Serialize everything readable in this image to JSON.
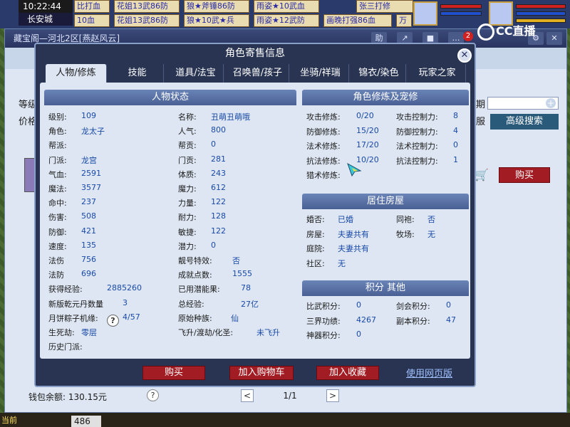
{
  "top_bar": {
    "time": "10:22:44",
    "map_name": "长安城",
    "ticker_row1": [
      "比打血",
      "花姐13武86防",
      "狼★斧锤86防",
      "雨姿★10武血",
      "张三打修"
    ],
    "ticker_row2": [
      "10血",
      "花姐13武86防",
      "狼★10武★兵",
      "雨姿★12武防",
      "画晚打强86血",
      "万"
    ]
  },
  "store": {
    "title": "藏宝阁—河北2区[燕赵风云]",
    "btn_labels": [
      "助",
      "↗",
      "■",
      "…"
    ],
    "notification_count": "2",
    "side_labels": [
      "等级",
      "价格"
    ],
    "side_label_right": "期",
    "side_label_right2": "服",
    "advanced_search": "高级搜索",
    "buy_button": "购买",
    "wallet": "钱包余额: 130.15元",
    "help": "?",
    "pager_prev": "<",
    "pager_text": "1/1",
    "pager_next": ">"
  },
  "overlay": {
    "cc_logo": "CC直播"
  },
  "bottom": {
    "left_label": "当前",
    "count": "486"
  },
  "dialog": {
    "title": "角色寄售信息",
    "close": "✕",
    "tabs": [
      "人物/修炼",
      "技能",
      "道具/法宝",
      "召唤兽/孩子",
      "坐骑/祥瑞",
      "锦衣/染色",
      "玩家之家"
    ],
    "left_panel": {
      "heading": "人物状态",
      "rows": [
        {
          "l1": "级别:",
          "v1": "109",
          "l2": "名称:",
          "v2": "丑萌丑萌哦"
        },
        {
          "l1": "角色:",
          "v1": "龙太子",
          "l2": "人气:",
          "v2": "800"
        },
        {
          "l1": "帮派:",
          "v1": "",
          "l2": "帮贡:",
          "v2": "0"
        },
        {
          "l1": "门派:",
          "v1": "龙宫",
          "l2": "门贡:",
          "v2": "281"
        },
        {
          "l1": "气血:",
          "v1": "2591",
          "l2": "体质:",
          "v2": "243"
        },
        {
          "l1": "魔法:",
          "v1": "3577",
          "l2": "魔力:",
          "v2": "612"
        },
        {
          "l1": "命中:",
          "v1": "237",
          "l2": "力量:",
          "v2": "122"
        },
        {
          "l1": "伤害:",
          "v1": "508",
          "l2": "耐力:",
          "v2": "128"
        },
        {
          "l1": "防御:",
          "v1": "421",
          "l2": "敏捷:",
          "v2": "122"
        },
        {
          "l1": "速度:",
          "v1": "135",
          "l2": "潜力:",
          "v2": "0"
        },
        {
          "l1": "法伤",
          "v1": "756",
          "l2": "靓号特效:",
          "v2": "否"
        },
        {
          "l1": "法防",
          "v1": "696",
          "l2": "成就点数:",
          "v2": "1555"
        },
        {
          "l1": "获得经验:",
          "v1": "2885260",
          "l2": "已用潜能果:",
          "v2": "78"
        },
        {
          "l1": "新版乾元丹数量",
          "v1": "3",
          "l2": "总经验:",
          "v2": "27亿"
        },
        {
          "l1": "月饼粽子机缘:",
          "v1": "4/57",
          "l2": "原始种族:",
          "v2": "仙"
        },
        {
          "l1": "生死劫:",
          "v1": "零层",
          "l2": "飞升/渡劫/化圣:",
          "v2": "未飞升"
        },
        {
          "l1": "历史门派:",
          "v1": "",
          "l2": "",
          "v2": ""
        }
      ]
    },
    "cultivation_panel": {
      "heading": "角色修炼及宠修",
      "rows": [
        {
          "l1": "攻击修炼:",
          "v1": "0/20",
          "l2": "攻击控制力:",
          "v2": "8"
        },
        {
          "l1": "防御修炼:",
          "v1": "15/20",
          "l2": "防御控制力:",
          "v2": "4"
        },
        {
          "l1": "法术修炼:",
          "v1": "17/20",
          "l2": "法术控制力:",
          "v2": "0"
        },
        {
          "l1": "抗法修炼:",
          "v1": "10/20",
          "l2": "抗法控制力:",
          "v2": "1"
        },
        {
          "l1": "猎术修炼:",
          "v1": "",
          "l2": "",
          "v2": ""
        }
      ]
    },
    "house_panel": {
      "heading": "居住房屋",
      "rows": [
        {
          "l1": "婚否:",
          "v1": "已婚",
          "l2": "同袍:",
          "v2": "否"
        },
        {
          "l1": "房屋:",
          "v1": "夫妻共有",
          "l2": "牧场:",
          "v2": "无"
        },
        {
          "l1": "庭院:",
          "v1": "夫妻共有",
          "l2": "",
          "v2": ""
        },
        {
          "l1": "社区:",
          "v1": "无",
          "l2": "",
          "v2": ""
        }
      ]
    },
    "points_panel": {
      "heading": "积分 其他",
      "rows": [
        {
          "l1": "比武积分:",
          "v1": "0",
          "l2": "剑会积分:",
          "v2": "0"
        },
        {
          "l1": "三界功绩:",
          "v1": "4267",
          "l2": "副本积分:",
          "v2": "47"
        },
        {
          "l1": "神器积分:",
          "v1": "0",
          "l2": "",
          "v2": ""
        }
      ]
    },
    "help_icon": "?",
    "buttons": {
      "buy": "购买",
      "add_cart": "加入购物车",
      "add_favorite": "加入收藏",
      "web_version": "使用网页版"
    }
  },
  "colors": {
    "dialog_bg": "#283452",
    "panel_bg": "#dde6f2",
    "panel_head": "#5a74a8",
    "value_text": "#1a4aa8",
    "button_red": "#a21c24"
  }
}
